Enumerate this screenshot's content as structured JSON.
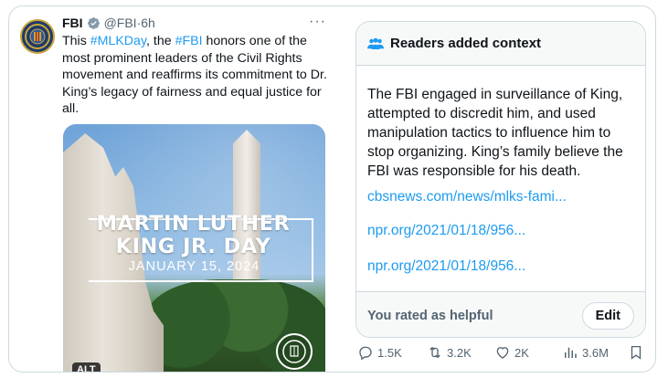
{
  "tweet": {
    "author_name": "FBI",
    "handle": "@FBI",
    "separator": "·",
    "time": "6h",
    "more_label": "···",
    "text_parts": [
      {
        "t": "This ",
        "tag": false
      },
      {
        "t": "#MLKDay",
        "tag": true
      },
      {
        "t": ", the ",
        "tag": false
      },
      {
        "t": "#FBI",
        "tag": true
      },
      {
        "t": " honors one of the most prominent leaders of the Civil Rights movement and reaffirms its commitment to Dr. King’s legacy of fairness and equal justice for all.",
        "tag": false
      }
    ]
  },
  "media": {
    "title_line1": "MARTIN LUTHER",
    "title_line2": "KING JR. DAY",
    "date": "JANUARY 15, 2024",
    "alt_badge": "ALT"
  },
  "note": {
    "header": "Readers added context",
    "body": "The FBI engaged in surveillance of King, attempted to discredit him, and used manipulation tactics to influence him to stop organizing. King’s family believe the FBI was responsible for his death.",
    "links": [
      "cbsnews.com/news/mlks-fami...",
      "npr.org/2021/01/18/956...",
      "npr.org/2021/01/18/956..."
    ],
    "rated_text": "You rated as helpful",
    "edit_label": "Edit"
  },
  "actions": {
    "replies": "1.5K",
    "reposts": "3.2K",
    "likes": "2K",
    "views": "3.6M"
  },
  "colors": {
    "accent": "#1d9bf0",
    "muted": "#536471",
    "border": "#cfd9de",
    "verified_gray": "#829aab"
  }
}
